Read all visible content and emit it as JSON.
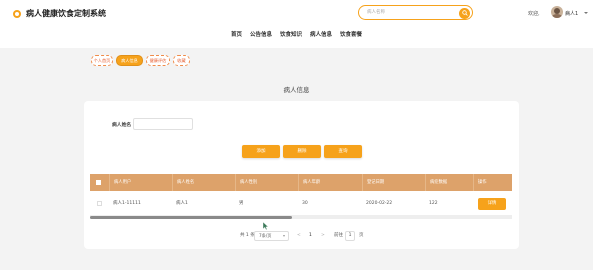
{
  "header": {
    "site_title": "病人健康饮食定制系统",
    "search_placeholder": "病人名称",
    "welcome": "欢迎,",
    "username": "病人1"
  },
  "nav": [
    "首页",
    "公告信息",
    "饮食知识",
    "病人信息",
    "饮食套餐"
  ],
  "breadcrumbs": [
    "个人首页",
    "病人信息",
    "健康评估",
    "收藏"
  ],
  "page_title": "病人信息",
  "filter": {
    "label": "病人姓名",
    "value": ""
  },
  "buttons": {
    "add": "添加",
    "delete": "删除",
    "query": "查询"
  },
  "table": {
    "columns": [
      "病人用户",
      "病人姓名",
      "病人性别",
      "病人年龄",
      "登记日期",
      "病症数据",
      "操作"
    ],
    "rows": [
      {
        "user": "病人1-11111",
        "name": "病人1",
        "gender": "男",
        "age": "30",
        "date": "2020-02-22",
        "data": "122",
        "action": "详情"
      }
    ]
  },
  "pagination": {
    "total": "共 1 条",
    "page_size": "7条/页",
    "prev": "<",
    "current": "1",
    "next": ">",
    "goto_label": "前往",
    "goto_value": "1",
    "page_unit": "页"
  },
  "colors": {
    "accent": "#f6a21b",
    "table_header": "#dda26a"
  }
}
